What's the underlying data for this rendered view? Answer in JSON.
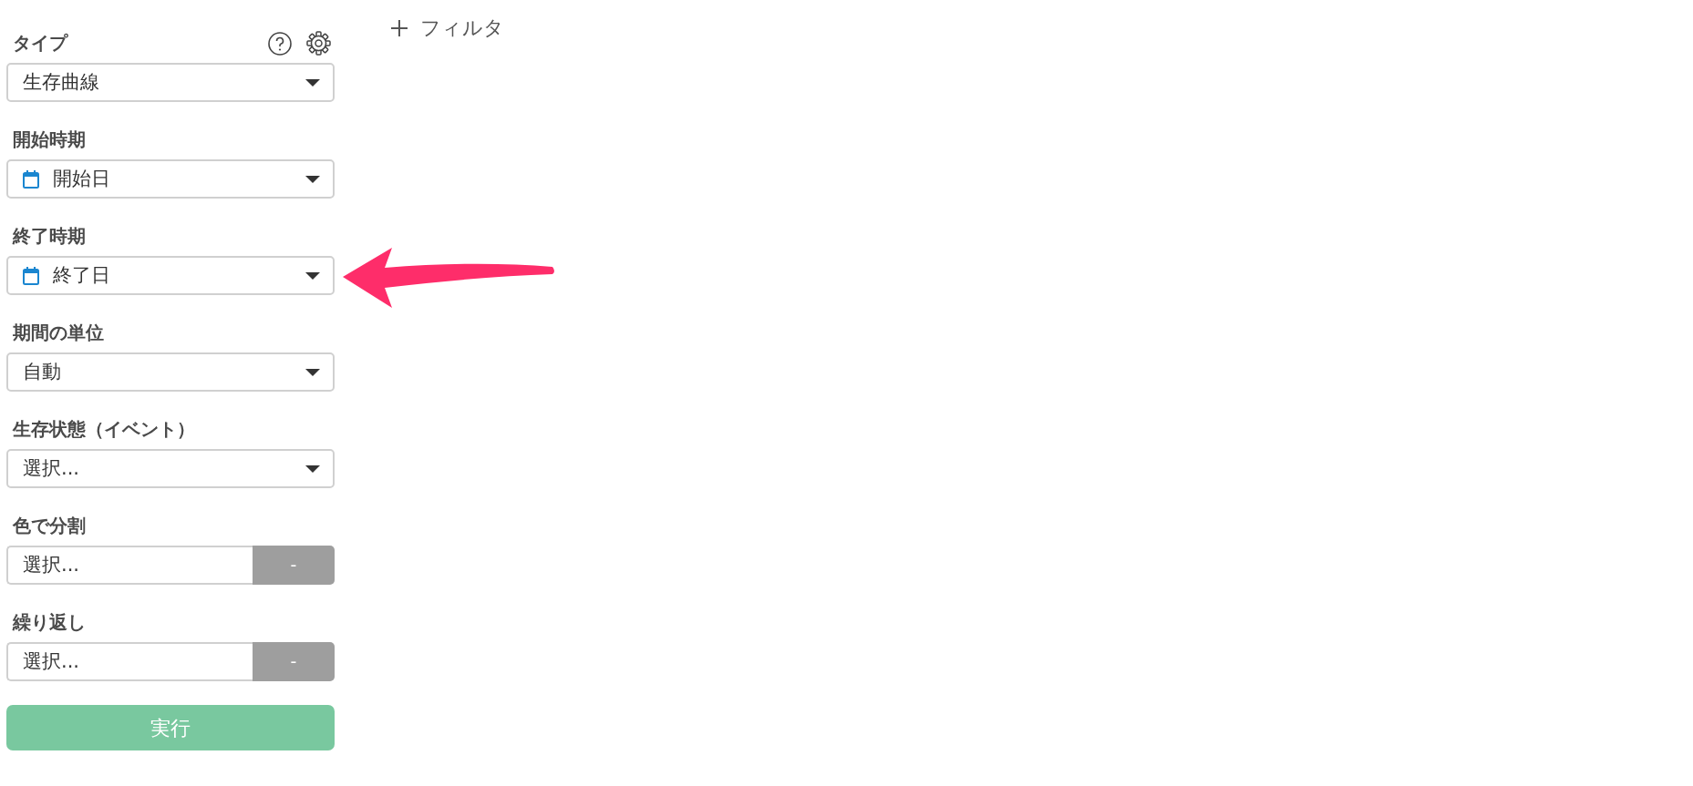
{
  "sidebar": {
    "fields": [
      {
        "label": "タイプ",
        "kind": "select",
        "value": "生存曲線",
        "header_tools": true
      },
      {
        "label": "開始時期",
        "kind": "date-select",
        "value": "開始日"
      },
      {
        "label": "終了時期",
        "kind": "date-select",
        "value": "終了日"
      },
      {
        "label": "期間の単位",
        "kind": "select",
        "value": "自動"
      },
      {
        "label": "生存状態（イベント）",
        "kind": "select",
        "value": "選択..."
      },
      {
        "label": "色で分割",
        "kind": "select-with-button",
        "value": "選択...",
        "button": "-"
      },
      {
        "label": "繰り返し",
        "kind": "select-with-button",
        "value": "選択...",
        "button": "-"
      }
    ],
    "run_button": "実行"
  },
  "filter_link": "フィルタ",
  "annotations": [
    {
      "kind": "arrow"
    }
  ]
}
